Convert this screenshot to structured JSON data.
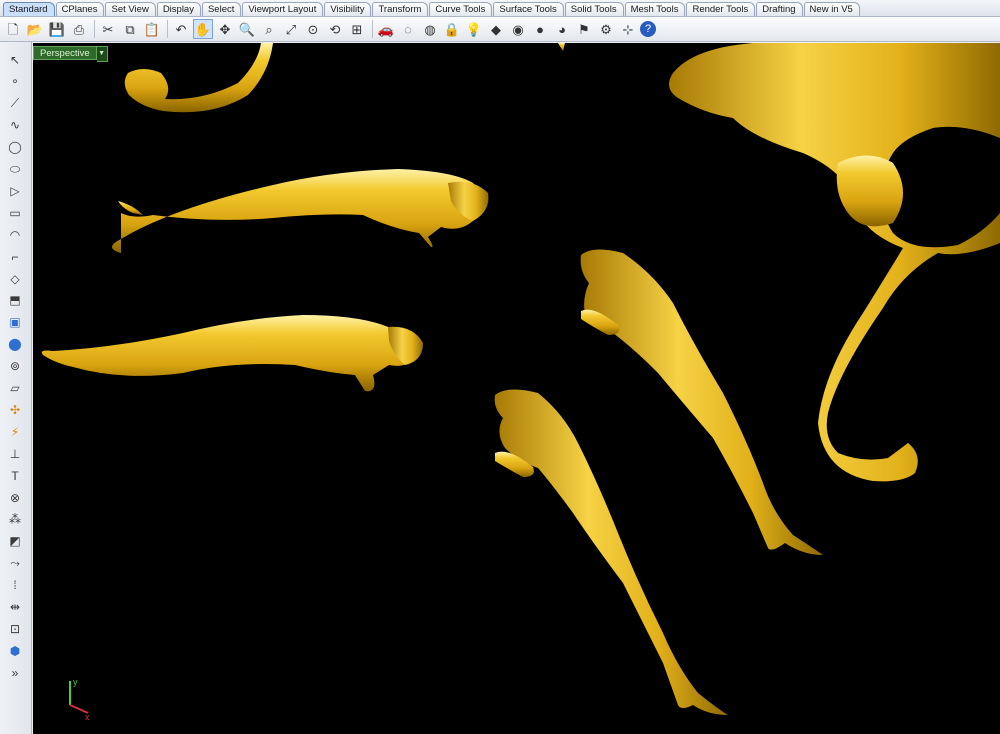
{
  "tabs": [
    "Standard",
    "CPlanes",
    "Set View",
    "Display",
    "Select",
    "Viewport Layout",
    "Visibility",
    "Transform",
    "Curve Tools",
    "Surface Tools",
    "Solid Tools",
    "Mesh Tools",
    "Render Tools",
    "Drafting",
    "New in V5"
  ],
  "toolbar_icons": [
    "new-file-icon",
    "open-file-icon",
    "save-icon",
    "print-icon",
    "cut-icon",
    "copy-icon",
    "paste-icon",
    "undo-icon",
    "pan-hand-icon",
    "move-icon",
    "zoom-icon",
    "zoom-window-icon",
    "zoom-extents-icon",
    "zoom-selected-icon",
    "rotate-view-icon",
    "four-viewports-icon",
    "car-icon",
    "hide-icon",
    "show-icon",
    "lock-icon",
    "light-icon",
    "layer-icon",
    "color-icon",
    "material-icon",
    "render-icon",
    "options-icon",
    "gear-icon",
    "grid-snap-icon",
    "help-icon"
  ],
  "sidebar_icons": [
    "select-arrow-icon",
    "point-icon",
    "polyline-icon",
    "curve-icon",
    "circle-icon",
    "ellipse-icon",
    "polygon-icon",
    "rectangle-icon",
    "arc-icon",
    "fillet-icon",
    "surface-icon",
    "extrude-icon",
    "box-solid-icon",
    "sphere-icon",
    "cylinder-icon",
    "plane-icon",
    "gumball-icon",
    "analyze-icon",
    "dimension-icon",
    "text-icon",
    "boolean-icon",
    "mesh-icon",
    "group-icon",
    "join-icon",
    "array-icon",
    "mirror-icon",
    "transform-icon",
    "block-icon",
    "more-icon"
  ],
  "viewport": {
    "title": "Perspective",
    "axis_labels": {
      "x": "x",
      "y": "y"
    }
  },
  "colors": {
    "gold": "#e3b51a",
    "gold_shadow": "#8a6400",
    "background": "#000000",
    "viewport_tab": "#2e6a2a"
  }
}
